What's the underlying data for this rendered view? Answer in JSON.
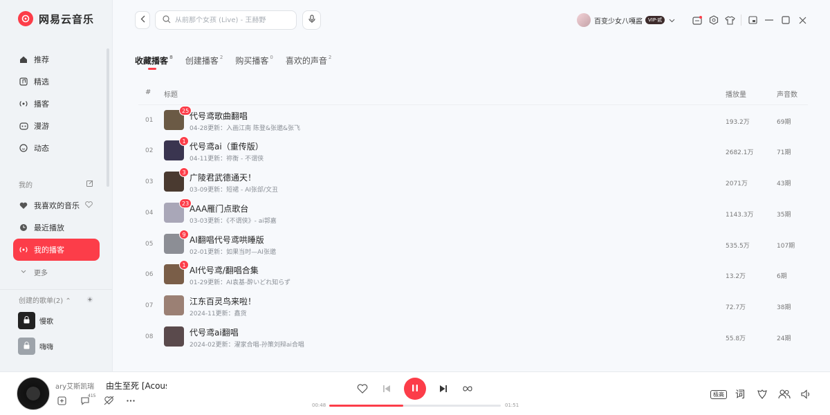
{
  "app": {
    "name": "网易云音乐",
    "brand_color": "#fc3d49"
  },
  "sidebar": {
    "nav": [
      {
        "label": "推荐",
        "icon": "home-icon"
      },
      {
        "label": "精选",
        "icon": "music-note-icon"
      },
      {
        "label": "播客",
        "icon": "podcast-icon"
      },
      {
        "label": "漫游",
        "icon": "roam-icon"
      },
      {
        "label": "动态",
        "icon": "chat-icon"
      }
    ],
    "mine_title": "我的",
    "mine": [
      {
        "label": "我喜欢的音乐",
        "icon": "heart-icon"
      },
      {
        "label": "最近播放",
        "icon": "clock-icon"
      },
      {
        "label": "我的播客",
        "icon": "podcast-icon",
        "active": true
      }
    ],
    "more": "更多",
    "created_title": "创建的歌单(2)",
    "playlists": [
      {
        "name": "慢歌"
      },
      {
        "name": "嗨嗨"
      }
    ]
  },
  "topbar": {
    "search_placeholder": "从前那个女孩 (Live) - 王赫野",
    "user_name": "百变少女八嘎酱",
    "vip": "VIP·贰"
  },
  "tabs": [
    {
      "label": "收藏播客",
      "count": "8",
      "active": true
    },
    {
      "label": "创建播客",
      "count": "2"
    },
    {
      "label": "购买播客",
      "count": "0"
    },
    {
      "label": "喜欢的声音",
      "count": "2"
    }
  ],
  "table": {
    "headers": {
      "index": "#",
      "title": "标题",
      "plays": "播放量",
      "episodes": "声音数"
    },
    "rows": [
      {
        "index": "01",
        "badge": "25",
        "title": "代号鸢歌曲翻唱",
        "sub": "04-28更新：入画江南 陈登&张邈&张飞",
        "plays": "193.2万",
        "episodes": "69期",
        "cover": "#6b5a45"
      },
      {
        "index": "02",
        "badge": "1",
        "title": "代号鸢ai（重传版）",
        "sub": "04-11更新：祢衡 - 不谓侠",
        "plays": "2682.1万",
        "episodes": "71期",
        "cover": "#3a3550"
      },
      {
        "index": "03",
        "badge": "3",
        "title": "广陵君武德通天！",
        "sub": "03-09更新：短裙 - AI张郃/文丑",
        "plays": "2071万",
        "episodes": "43期",
        "cover": "#4a3a30"
      },
      {
        "index": "04",
        "badge": "23",
        "title": "AAA雁门点歌台",
        "sub": "03-03更新：《不谓侠》- ai郭嘉",
        "plays": "1143.3万",
        "episodes": "35期",
        "cover": "#a9a7b8"
      },
      {
        "index": "05",
        "badge": "9",
        "title": "AI翻唱代号鸢哄睡版",
        "sub": "02-01更新：如果当时—AI张邈",
        "plays": "535.5万",
        "episodes": "107期",
        "cover": "#8c8e95"
      },
      {
        "index": "06",
        "badge": "1",
        "title": "AI代号鸢/翻唱合集",
        "sub": "01-29更新：AI袁基-酔いどれ知らず",
        "plays": "13.2万",
        "episodes": "6期",
        "cover": "#7a5e48"
      },
      {
        "index": "07",
        "badge": "",
        "title": "江东百灵鸟来啦！",
        "sub": "2024-11更新：鑫货",
        "plays": "72.7万",
        "episodes": "38期",
        "cover": "#9b8074"
      },
      {
        "index": "08",
        "badge": "",
        "title": "代号鸢ai翻唱",
        "sub": "2024-02更新：濯家合唱-孙策刘辩ai合唱",
        "plays": "55.8万",
        "episodes": "24期",
        "cover": "#5a4a4c"
      }
    ]
  },
  "player": {
    "artist": "ary艾斯凯瑞",
    "song": "由生至死 [Acoustic]",
    "comment_count": "415",
    "elapsed": "00:48",
    "total": "01:51",
    "progress": 0.43,
    "quality": "极高",
    "lyrics_label": "词"
  }
}
